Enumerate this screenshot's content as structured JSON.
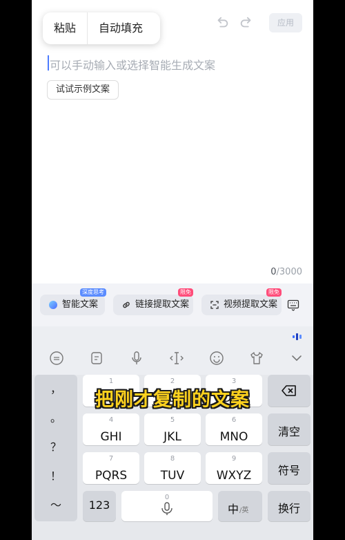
{
  "context_menu": {
    "paste": "粘贴",
    "autofill": "自动填充"
  },
  "editor": {
    "apply_label": "应用",
    "placeholder": "可以手动输入或选择智能生成文案",
    "example_button": "试试示例文案",
    "char_count": "0",
    "char_limit": "/3000"
  },
  "toolbar": {
    "smart_copy": {
      "label": "智能文案",
      "badge": "深度思考"
    },
    "link_extract": {
      "label": "链接提取文案",
      "badge": "限免"
    },
    "video_extract": {
      "label": "视频提取文案",
      "badge": "限免"
    }
  },
  "keyboard": {
    "toolbar_icons": [
      "emoji-face-icon",
      "clipboard-icon",
      "microphone-icon",
      "cursor-move-icon",
      "smile-icon",
      "skin-icon",
      "collapse-chevron-icon"
    ],
    "punctuation": [
      "，",
      "。",
      "？",
      "！",
      "～"
    ],
    "rows": [
      [
        {
          "num": "1",
          "label": ""
        },
        {
          "num": "2",
          "label": "ABC"
        },
        {
          "num": "3",
          "label": "DEF"
        }
      ],
      [
        {
          "num": "4",
          "label": "GHI"
        },
        {
          "num": "5",
          "label": "JKL"
        },
        {
          "num": "6",
          "label": "MNO"
        }
      ],
      [
        {
          "num": "7",
          "label": "PQRS"
        },
        {
          "num": "8",
          "label": "TUV"
        },
        {
          "num": "9",
          "label": "WXYZ"
        }
      ]
    ],
    "clear_label": "清空",
    "symbol_label": "符号",
    "num_label": "123",
    "space_num": "0",
    "lang_main": "中",
    "lang_alt": "/英",
    "enter_label": "换行"
  },
  "overlay_caption": "把刚才复制的文案",
  "colors": {
    "accent": "#4d7cff",
    "caption": "#ffd21e",
    "badge_blue": "#5b8cff",
    "badge_red": "#ff4d7a"
  }
}
